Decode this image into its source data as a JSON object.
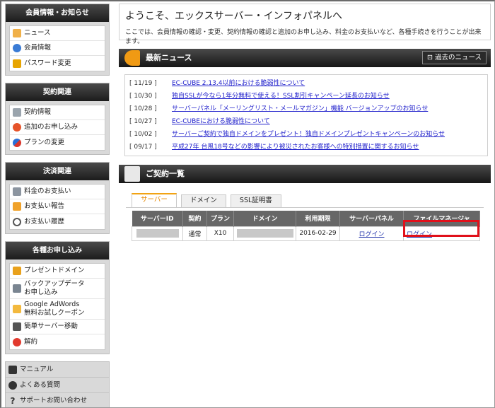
{
  "sidebar": {
    "sections": [
      {
        "title": "会員情報・お知らせ",
        "items": [
          {
            "label": "ニュース",
            "icon": "news-icon"
          },
          {
            "label": "会員情報",
            "icon": "user-icon"
          },
          {
            "label": "パスワード変更",
            "icon": "lock-icon"
          }
        ]
      },
      {
        "title": "契約関連",
        "items": [
          {
            "label": "契約情報",
            "icon": "contract-icon"
          },
          {
            "label": "追加のお申し込み",
            "icon": "plus-icon"
          },
          {
            "label": "プランの変更",
            "icon": "refresh-icon"
          }
        ]
      },
      {
        "title": "決済関連",
        "items": [
          {
            "label": "料金のお支払い",
            "icon": "calculator-icon"
          },
          {
            "label": "お支払い報告",
            "icon": "report-icon"
          },
          {
            "label": "お支払い履歴",
            "icon": "clock-icon"
          }
        ]
      },
      {
        "title": "各種お申し込み",
        "items": [
          {
            "label": "プレゼントドメイン",
            "icon": "gift-icon"
          },
          {
            "label": "バックアップデータ",
            "label2": "お申し込み",
            "icon": "backup-icon"
          },
          {
            "label": "Google AdWords",
            "label2": "無料お試しクーポン",
            "icon": "coupon-icon"
          },
          {
            "label": "簡単サーバー移動",
            "icon": "server-move-icon"
          },
          {
            "label": "解約",
            "icon": "cancel-icon"
          }
        ]
      }
    ],
    "bottom": [
      {
        "label": "マニュアル",
        "icon": "book-icon"
      },
      {
        "label": "よくある質問",
        "icon": "speech-icon"
      },
      {
        "label": "サポートお問い合わせ",
        "icon": "question-icon"
      }
    ]
  },
  "welcome": {
    "title": "ようこそ、エックスサーバー・インフォパネルへ",
    "desc": "ここでは、会員情報の確認・変更、契約情報の確認と追加のお申し込み、料金のお支払いなど、各種手続きを行うことが出来ます。"
  },
  "news": {
    "title": "最新ニュース",
    "past_button": "過去のニュース",
    "items": [
      {
        "date": "[ 11/19 ]",
        "text": "EC-CUBE 2.13.4以前における脆弱性について"
      },
      {
        "date": "[ 10/30 ]",
        "text": "独自SSLが今なら1年分無料で使える！SSL割引キャンペーン延長のお知らせ"
      },
      {
        "date": "[ 10/28 ]",
        "text": "サーバーパネル「メーリングリスト・メールマガジン」機能 バージョンアップのお知らせ"
      },
      {
        "date": "[ 10/27 ]",
        "text": "EC-CUBEにおける脆弱性について"
      },
      {
        "date": "[ 10/02 ]",
        "text": "サーバーご契約で独自ドメインをプレゼント！独自ドメインプレゼントキャンペーンのお知らせ"
      },
      {
        "date": "[ 09/17 ]",
        "text": "平成27年 台風18号などの影響により被災されたお客様への特別措置に関するお知らせ"
      }
    ]
  },
  "contracts": {
    "title": "ご契約一覧",
    "tabs": [
      "サーバー",
      "ドメイン",
      "SSL証明書"
    ],
    "columns": [
      "サーバーID",
      "契約",
      "プラン",
      "ドメイン",
      "利用期限",
      "サーバーパネル",
      "ファイルマネージャ"
    ],
    "row": {
      "contract": "通常",
      "plan": "X10",
      "expiry": "2016-02-29",
      "panel_link": "ログイン",
      "fm_link": "ログイン"
    }
  },
  "colors": {
    "accent": "#f2a313",
    "highlight": "#e0101a",
    "link": "#2222cc"
  }
}
